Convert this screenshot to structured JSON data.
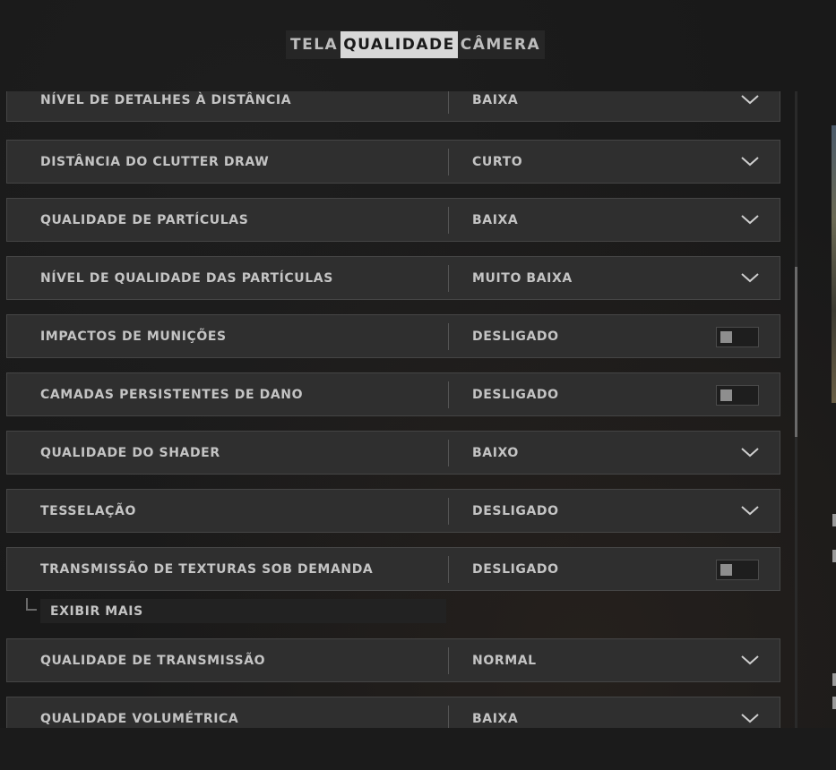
{
  "tabs": [
    {
      "label": "TELA",
      "active": false
    },
    {
      "label": "QUALIDADE",
      "active": true
    },
    {
      "label": "CÂMERA",
      "active": false
    }
  ],
  "settings": [
    {
      "label": "NÍVEL DE DETALHES À DISTÂNCIA",
      "value": "BAIXA",
      "control": "dropdown"
    },
    {
      "label": "DISTÂNCIA DO CLUTTER DRAW",
      "value": "CURTO",
      "control": "dropdown"
    },
    {
      "label": "QUALIDADE DE PARTÍCULAS",
      "value": "BAIXA",
      "control": "dropdown"
    },
    {
      "label": "NÍVEL DE QUALIDADE DAS PARTÍCULAS",
      "value": "MUITO BAIXA",
      "control": "dropdown"
    },
    {
      "label": "IMPACTOS DE MUNIÇÕES",
      "value": "DESLIGADO",
      "control": "toggle"
    },
    {
      "label": "CAMADAS PERSISTENTES DE DANO",
      "value": "DESLIGADO",
      "control": "toggle"
    },
    {
      "label": "QUALIDADE DO SHADER",
      "value": "BAIXO",
      "control": "dropdown"
    },
    {
      "label": "TESSELAÇÃO",
      "value": "DESLIGADO",
      "control": "dropdown"
    },
    {
      "label": "TRANSMISSÃO DE TEXTURAS SOB DEMANDA",
      "value": "DESLIGADO",
      "control": "toggle"
    },
    {
      "label": "QUALIDADE DE TRANSMISSÃO",
      "value": "NORMAL",
      "control": "dropdown"
    },
    {
      "label": "QUALIDADE VOLUMÉTRICA",
      "value": "BAIXA",
      "control": "dropdown"
    }
  ],
  "show_more": {
    "label": "EXIBIR MAIS"
  },
  "icons": {
    "dropdown": "chevron-down-icon",
    "toggle": "toggle-switch"
  },
  "colors": {
    "row_bg": "#2f2f2f",
    "tab_active_bg": "#d8d8d8",
    "text": "#c4c4c4"
  }
}
